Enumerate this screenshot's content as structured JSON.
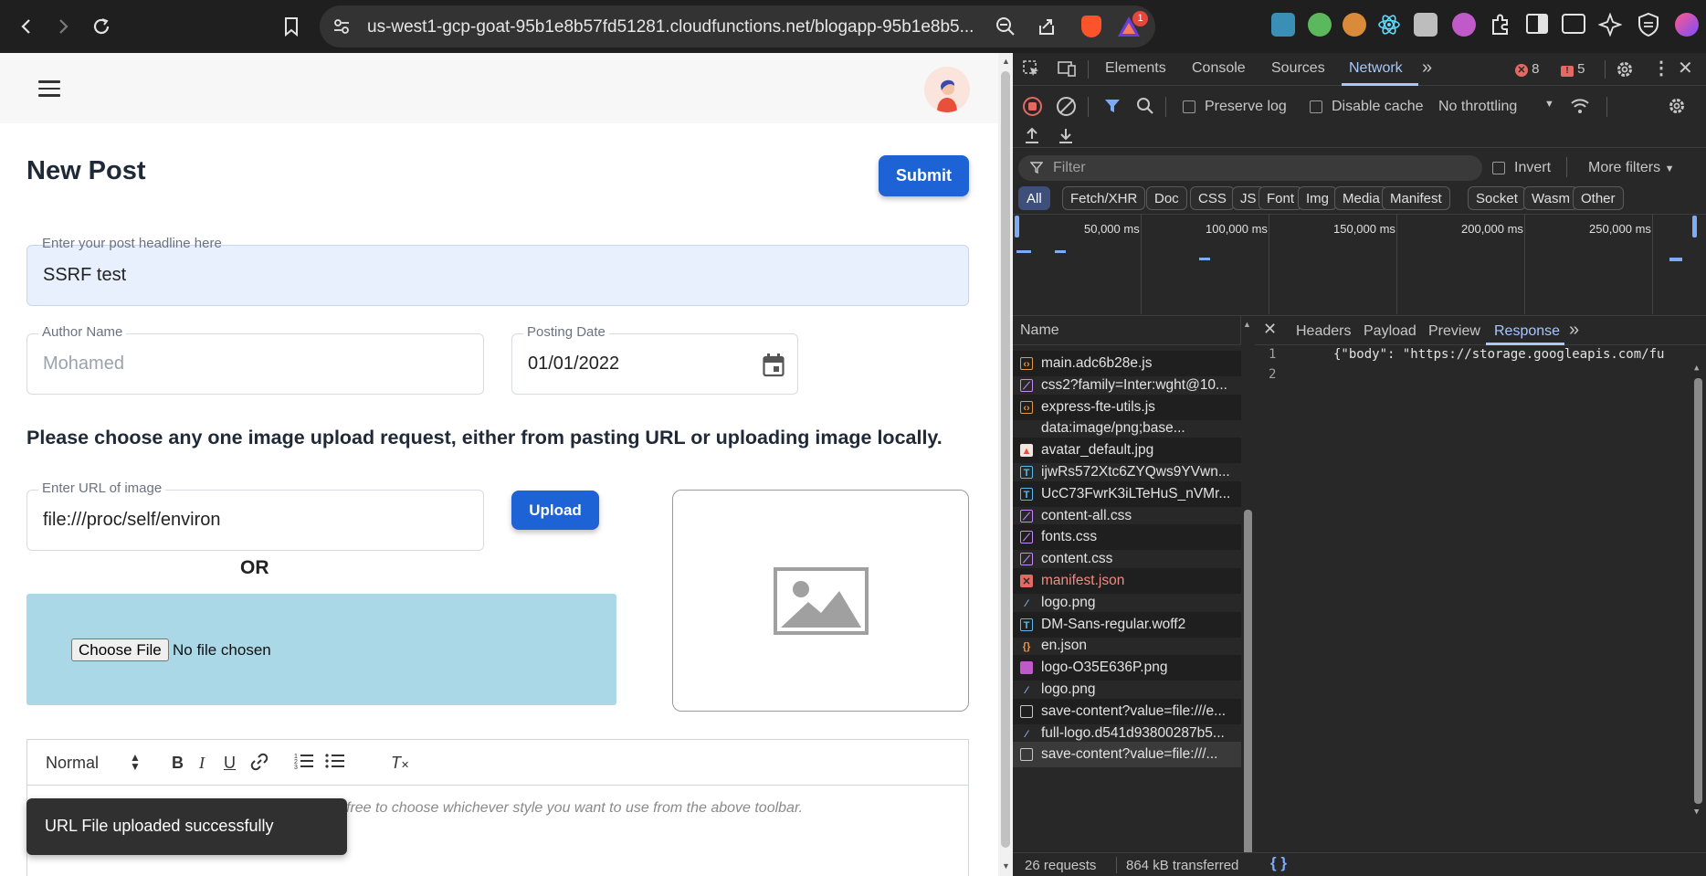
{
  "browser": {
    "url": "us-west1-gcp-goat-95b1e8b57fd51281.cloudfunctions.net/blogapp-95b1e8b5...",
    "notification_count": "1"
  },
  "page": {
    "title": "New Post",
    "submit_label": "Submit",
    "headline": {
      "label": "Enter your post headline here",
      "value": "SSRF test"
    },
    "author": {
      "label": "Author Name",
      "placeholder": "Mohamed"
    },
    "date": {
      "label": "Posting Date",
      "value": "01/01/2022"
    },
    "question": "Please choose any one image upload request, either from pasting URL or uploading image locally.",
    "url_field": {
      "label": "Enter URL of image",
      "value": "file:///proc/self/environ"
    },
    "upload_label": "Upload",
    "or_text": "OR",
    "choose_file_label": "Choose File",
    "no_file_text": "No file chosen",
    "editor": {
      "format": "Normal",
      "placeholder": "free to choose whichever style you want to use from the above toolbar."
    },
    "toast": "URL File uploaded successfully"
  },
  "devtools": {
    "tabs": [
      "Elements",
      "Console",
      "Sources",
      "Network"
    ],
    "active_tab": "Network",
    "error_count": "8",
    "warning_count": "5",
    "preserve_log": "Preserve log",
    "disable_cache": "Disable cache",
    "throttling": "No throttling",
    "filter_placeholder": "Filter",
    "invert": "Invert",
    "more_filters": "More filters",
    "type_filters": [
      "All",
      "Fetch/XHR",
      "Doc",
      "CSS",
      "JS",
      "Font",
      "Img",
      "Media",
      "Manifest",
      "Socket",
      "Wasm",
      "Other"
    ],
    "timeline_labels": [
      "50,000 ms",
      "100,000 ms",
      "150,000 ms",
      "200,000 ms",
      "250,000 ms"
    ],
    "name_header": "Name",
    "requests": [
      {
        "name": "main.adc6b28e.js",
        "type": "js"
      },
      {
        "name": "css2?family=Inter:wght@10...",
        "type": "css"
      },
      {
        "name": "express-fte-utils.js",
        "type": "js"
      },
      {
        "name": "data:image/png;base...",
        "type": "data"
      },
      {
        "name": "avatar_default.jpg",
        "type": "img"
      },
      {
        "name": "ijwRs572Xtc6ZYQws9YVwn...",
        "type": "font"
      },
      {
        "name": "UcC73FwrK3iLTeHuS_nVMr...",
        "type": "font"
      },
      {
        "name": "content-all.css",
        "type": "css"
      },
      {
        "name": "fonts.css",
        "type": "css"
      },
      {
        "name": "content.css",
        "type": "css"
      },
      {
        "name": "manifest.json",
        "type": "error"
      },
      {
        "name": "logo.png",
        "type": "img2"
      },
      {
        "name": "DM-Sans-regular.woff2",
        "type": "font"
      },
      {
        "name": "en.json",
        "type": "json"
      },
      {
        "name": "logo-O35E636P.png",
        "type": "brain"
      },
      {
        "name": "logo.png",
        "type": "img2"
      },
      {
        "name": "save-content?value=file:///e...",
        "type": "doc"
      },
      {
        "name": "full-logo.d541d93800287b5...",
        "type": "img2"
      },
      {
        "name": "save-content?value=file:///...",
        "type": "doc"
      }
    ],
    "detail_tabs": [
      "Headers",
      "Payload",
      "Preview",
      "Response"
    ],
    "active_detail_tab": "Response",
    "response_lines": [
      "{\"body\": \"https://storage.googleapis.com/fu",
      ""
    ],
    "line_numbers": [
      "1",
      "2"
    ],
    "status_requests": "26 requests",
    "status_transferred": "864 kB transferred"
  }
}
